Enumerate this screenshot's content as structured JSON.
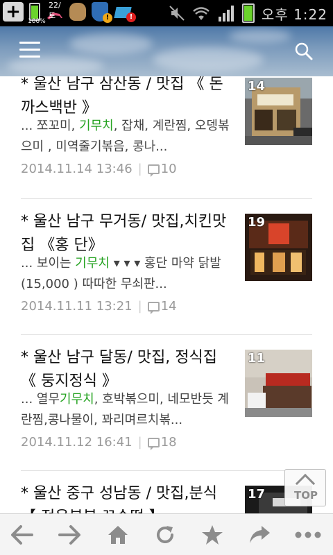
{
  "status_bar": {
    "battery_small_pct": "100%",
    "date_label": "22/토",
    "time": "오후 1:22"
  },
  "header": {
    "menu_icon": "hamburger-menu-icon",
    "search_icon": "search-icon"
  },
  "posts": [
    {
      "title": "* 울산 남구 삼산동 / 맛집 《 돈까스백반 》",
      "excerpt_before": "... 쪼꼬미, ",
      "excerpt_highlight": "기무치",
      "excerpt_after": ", 잡채, 계란찜, 오뎅볶으미 , 미역줄기볶음, 콩나...",
      "date": "2014.11.14 13:46",
      "comments": "10",
      "thumb_count": "14"
    },
    {
      "title": "* 울산 남구 무거동/ 맛집,치킨맛집 《홍 단》",
      "excerpt_before": "... 보이는 ",
      "excerpt_highlight": "기무치",
      "excerpt_after": " ▾ ▾ ▾ 홍단 마약 닭발 (15,000 ) 따따한 무쇠판...",
      "date": "2014.11.11 13:21",
      "comments": "14",
      "thumb_count": "19"
    },
    {
      "title": "* 울산 남구 달동/ 맛집, 정식집 《 둥지정식 》",
      "excerpt_before": "... 열무",
      "excerpt_highlight": "기무치",
      "excerpt_after": ", 호박볶으미, 네모반듯 계란찜,콩나물이, 꽈리며르치볶...",
      "date": "2014.11.12 16:41",
      "comments": "18",
      "thumb_count": "11"
    },
    {
      "title": "* 울산 중구 성남동 / 맛집,분식 【 정은분분 꼬순떡 】",
      "thumb_count": "17"
    }
  ],
  "top_button": {
    "label": "TOP"
  },
  "bottom_bar": {
    "icons": [
      "back-arrow-icon",
      "forward-arrow-icon",
      "home-icon",
      "refresh-icon",
      "star-icon",
      "share-icon",
      "more-icon"
    ]
  },
  "colors": {
    "highlight": "#23a21f",
    "meta_text": "#9a9a9a",
    "header_sky": "#6b8fb5"
  }
}
